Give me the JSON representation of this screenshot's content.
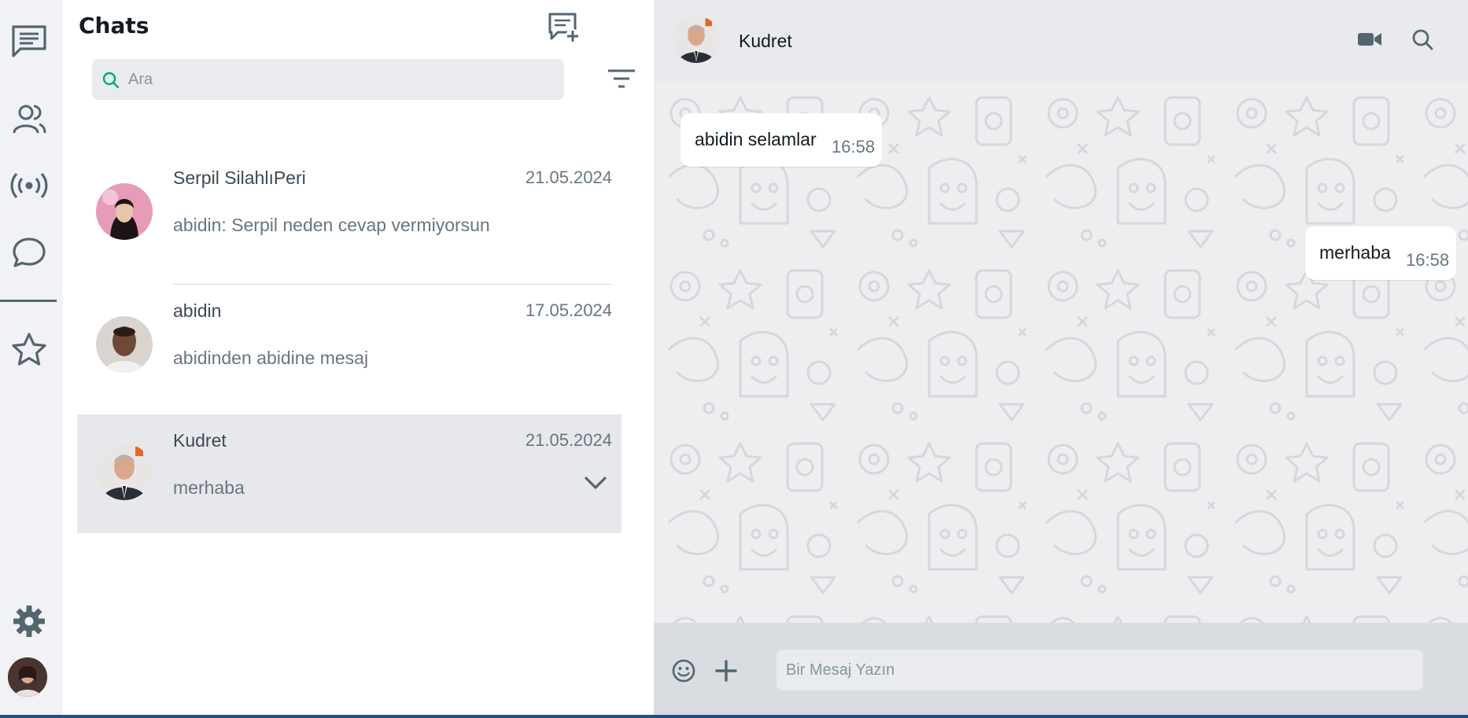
{
  "panel": {
    "title": "Chats",
    "search_placeholder": "Ara"
  },
  "rail": {
    "items": [
      "chats-icon",
      "communities-icon",
      "broadcast-icon",
      "status-icon",
      "starred-icon",
      "settings-icon"
    ]
  },
  "chats": [
    {
      "name": "Serpil SilahlıPeri",
      "date": "21.05.2024",
      "preview": "abidin: Serpil neden cevap vermiyorsun"
    },
    {
      "name": "abidin",
      "date": "17.05.2024",
      "preview": "abidinden abidine mesaj"
    },
    {
      "name": "Kudret",
      "date": "21.05.2024",
      "preview": "merhaba"
    }
  ],
  "conversation": {
    "name": "Kudret",
    "messages": [
      {
        "text": "abidin selamlar",
        "time": "16:58",
        "direction": "incoming"
      },
      {
        "text": "merhaba",
        "time": "16:58",
        "direction": "outgoing"
      }
    ],
    "input_placeholder": "Bir Mesaj Yazın"
  },
  "colors": {
    "accent": "#00a884",
    "icon": "#54656f",
    "active_row": "#e6e8ec"
  }
}
